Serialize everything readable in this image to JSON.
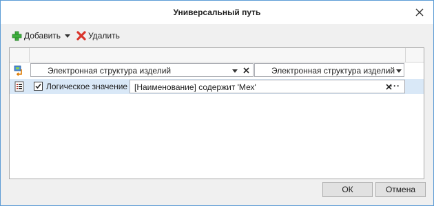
{
  "dialog": {
    "title": "Универсальный путь",
    "close_icon": "close-icon"
  },
  "toolbar": {
    "add_label": "Добавить",
    "add_icon": "green-plus-icon",
    "delete_label": "Удалить",
    "delete_icon": "red-x-icon"
  },
  "grid": {
    "rows": [
      {
        "icon": "structure-link-icon",
        "source_combo": "Электронная структура изделий",
        "target_combo": "Электронная структура изделий"
      },
      {
        "icon": "list-icon",
        "checked": true,
        "type_label": "Логическое значение",
        "condition": "[Наименование] содержит 'Мех'",
        "dots": "···"
      }
    ]
  },
  "buttons": {
    "ok": "ОК",
    "cancel": "Отмена"
  },
  "colors": {
    "accent_border": "#5b9bd5",
    "selected_row": "#d9e8f7"
  }
}
